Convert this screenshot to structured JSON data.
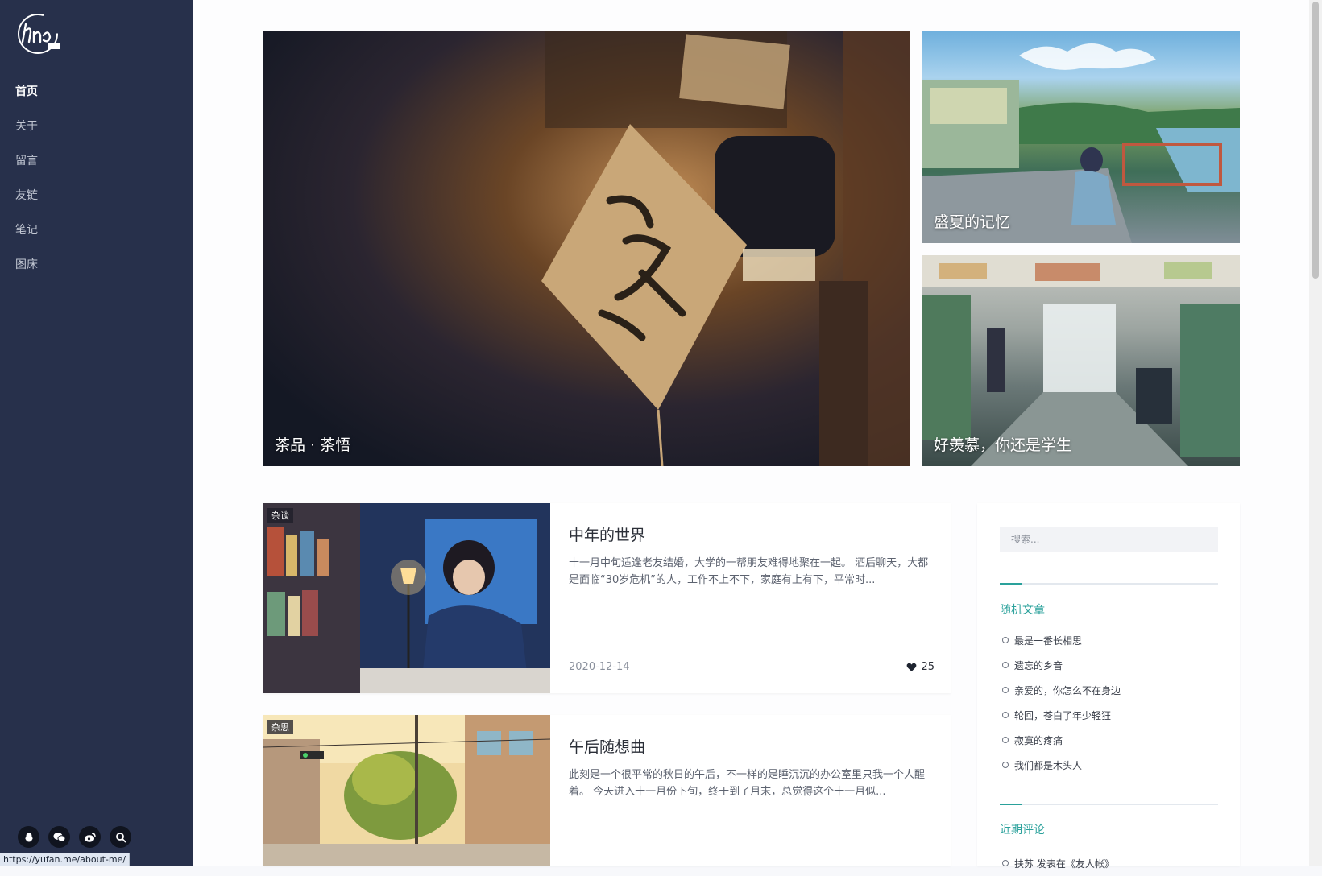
{
  "sidebar": {
    "logo_text": "fyfn",
    "nav": [
      {
        "label": "首页",
        "active": true
      },
      {
        "label": "关于",
        "active": false
      },
      {
        "label": "留言",
        "active": false
      },
      {
        "label": "友链",
        "active": false
      },
      {
        "label": "笔记",
        "active": false
      },
      {
        "label": "图床",
        "active": false
      }
    ],
    "social_icons": [
      "qq-icon",
      "wechat-icon",
      "weibo-icon",
      "search-icon"
    ]
  },
  "status_bar": {
    "url": "https://yufan.me/about-me/"
  },
  "hero": {
    "big": {
      "caption": "茶品 · 茶悟"
    },
    "small1": {
      "caption": "盛夏的记忆"
    },
    "small2": {
      "caption": "好羡慕，你还是学生"
    }
  },
  "posts": [
    {
      "tag": "杂谈",
      "title": "中年的世界",
      "excerpt": "十一月中旬适逢老友结婚，大学的一帮朋友难得地聚在一起。 酒后聊天，大都是面临“30岁危机”的人，工作不上不下，家庭有上有下，平常时...",
      "date": "2020-12-14",
      "likes": "25"
    },
    {
      "tag": "杂思",
      "title": "午后随想曲",
      "excerpt": "此刻是一个很平常的秋日的午后，不一样的是睡沉沉的办公室里只我一个人醒着。 今天进入十一月份下旬，终于到了月末，总觉得这个十一月似..."
    }
  ],
  "widget": {
    "search_placeholder": "搜索...",
    "random_title": "随机文章",
    "random_posts": [
      "最是一番长相思",
      "遗忘的乡音",
      "亲爱的，你怎么不在身边",
      "轮回，苍白了年少轻狂",
      "寂寞的疼痛",
      "我们都是木头人"
    ],
    "comments_title": "近期评论",
    "comments": [
      "扶苏 发表在《友人帐》"
    ]
  },
  "colors": {
    "sidebar_bg": "#27304b",
    "accent": "#2aa19b"
  }
}
